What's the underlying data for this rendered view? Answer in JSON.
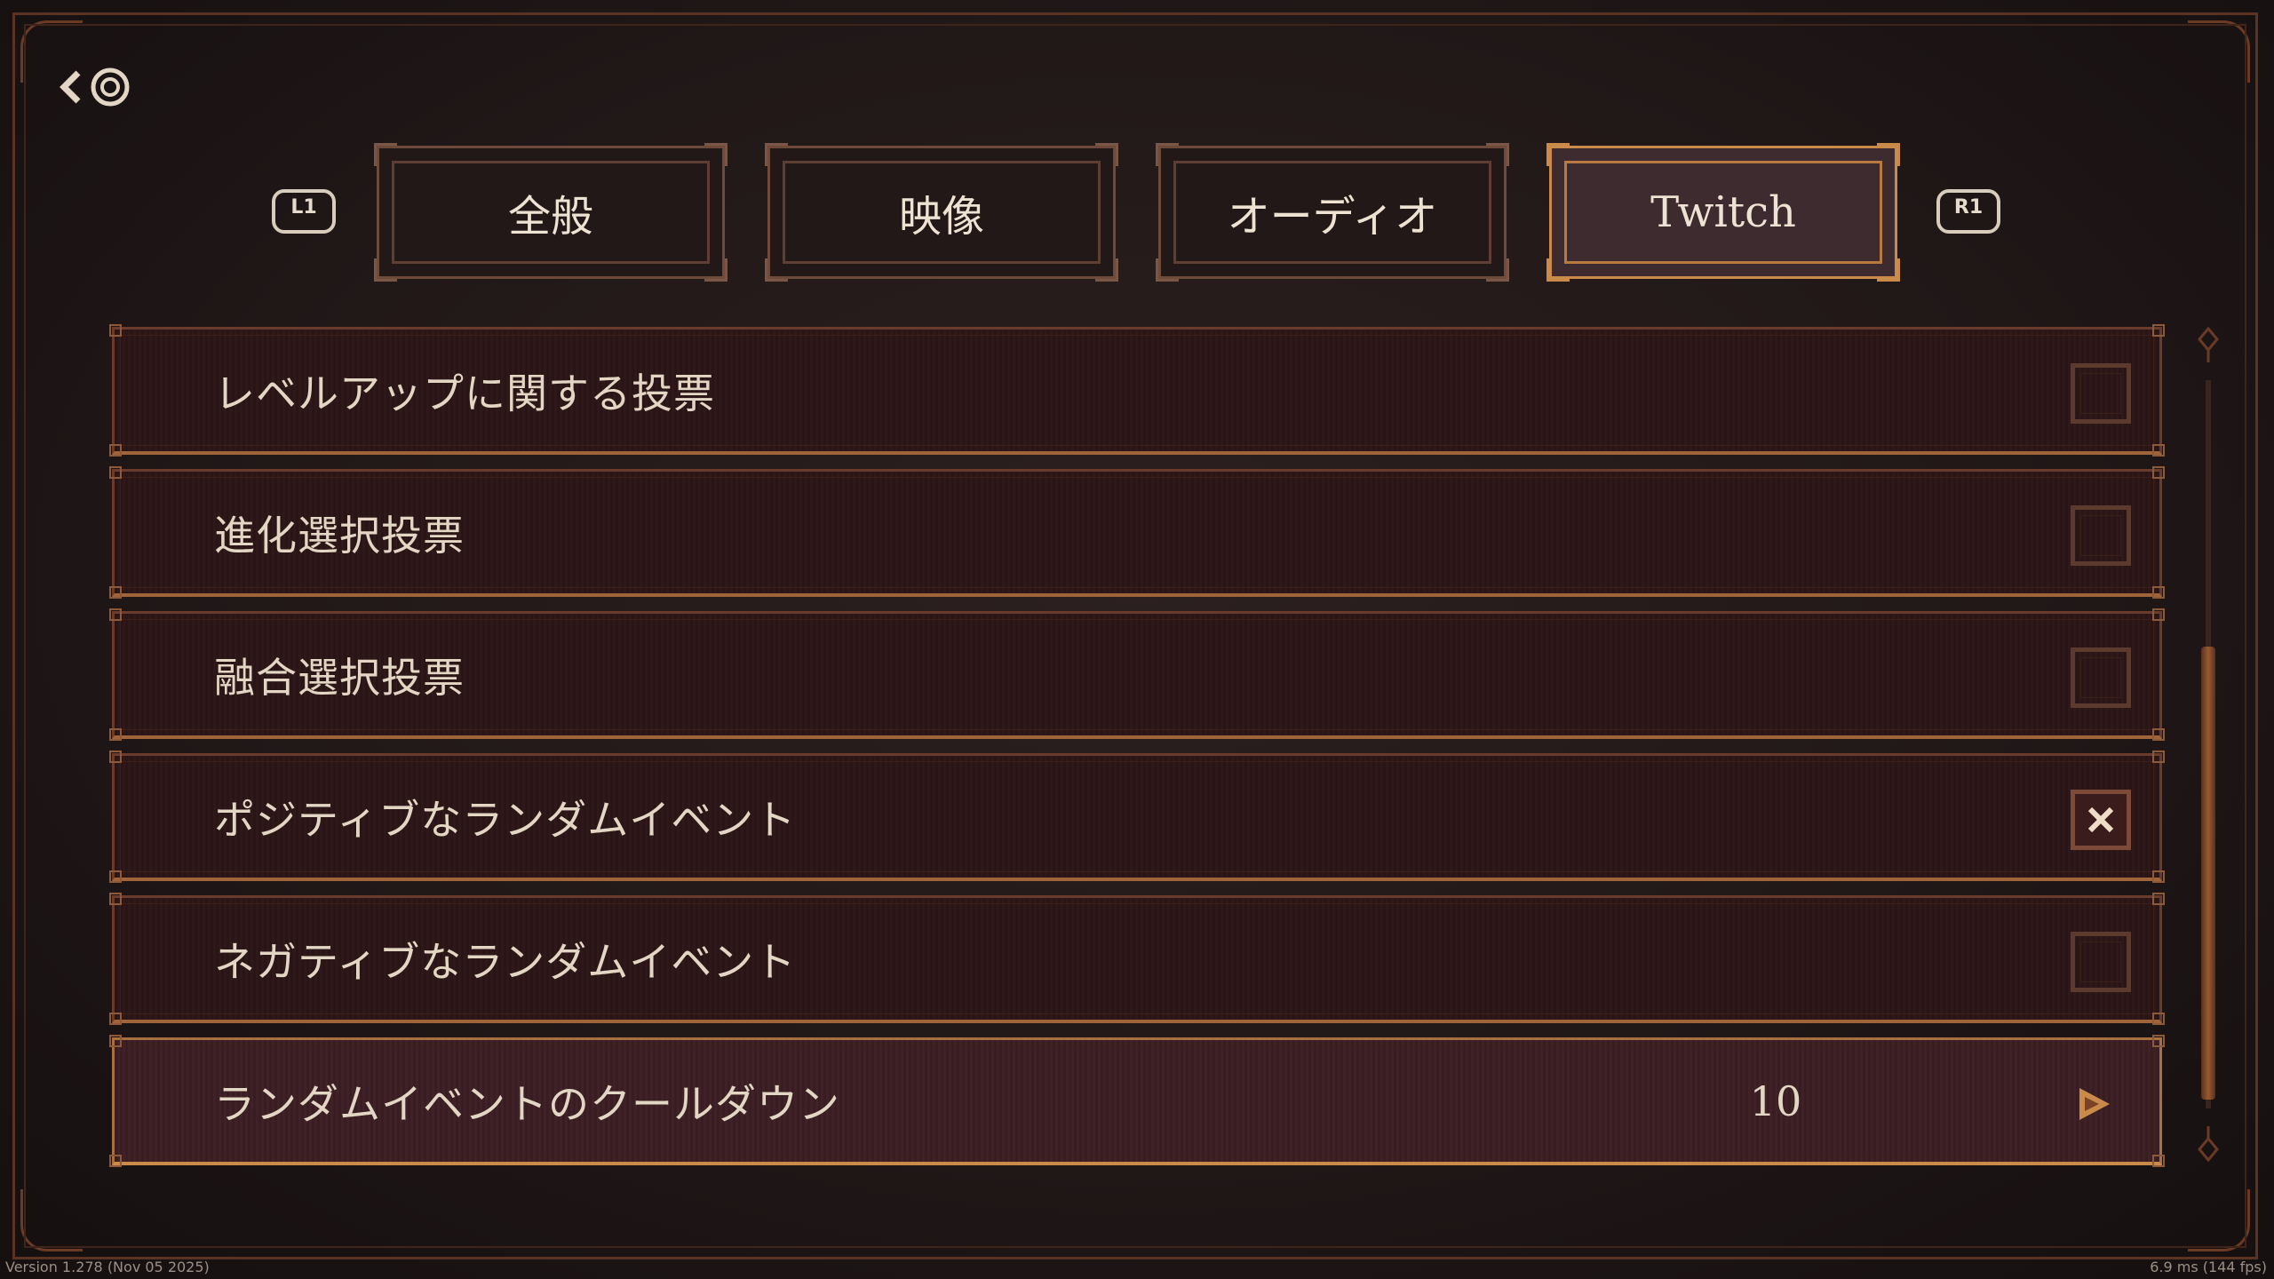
{
  "tabs": [
    {
      "label": "全般",
      "active": false
    },
    {
      "label": "映像",
      "active": false
    },
    {
      "label": "オーディオ",
      "active": false
    },
    {
      "label": "Twitch",
      "active": true
    }
  ],
  "shoulder_buttons": {
    "left": "L1",
    "right": "R1"
  },
  "back_button": {
    "icon": "back-arrow-icon",
    "button_glyph": "circle-button-icon"
  },
  "settings": [
    {
      "label": "レベルアップに関する投票",
      "type": "checkbox",
      "checked": false
    },
    {
      "label": "進化選択投票",
      "type": "checkbox",
      "checked": false
    },
    {
      "label": "融合選択投票",
      "type": "checkbox",
      "checked": false
    },
    {
      "label": "ポジティブなランダムイベント",
      "type": "checkbox",
      "checked": true
    },
    {
      "label": "ネガティブなランダムイベント",
      "type": "checkbox",
      "checked": false
    },
    {
      "label": "ランダムイベントのクールダウン",
      "type": "stepper",
      "value": "10"
    }
  ],
  "footer": {
    "version": "Version 1.278 (Nov 05 2025)",
    "fps": "6.9 ms (144 fps)"
  },
  "colors": {
    "accent": "#c98a4a",
    "background": "#211818",
    "row": "#2c1718",
    "text": "#e3d6c4"
  }
}
